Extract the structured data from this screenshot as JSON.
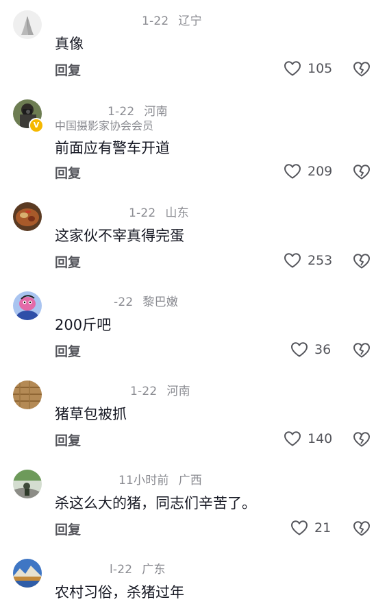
{
  "comments": [
    {
      "date": "1-22",
      "location": "辽宁",
      "badge": "",
      "text": "真像",
      "reply": "回复",
      "likes": "105",
      "avatar_icon": "praying-hands-avatar"
    },
    {
      "date": "1-22",
      "location": "河南",
      "badge": "中国摄影家协会会员",
      "text": "前面应有警车开道",
      "reply": "回复",
      "likes": "209",
      "avatar_icon": "photographer-avatar",
      "verified_mark": "V"
    },
    {
      "date": "1-22",
      "location": "山东",
      "badge": "",
      "text": "这家伙不宰真得完蛋",
      "reply": "回复",
      "likes": "253",
      "avatar_icon": "food-bowl-avatar"
    },
    {
      "date": "-22",
      "location": "黎巴嫩",
      "badge": "",
      "text": "200斤吧",
      "reply": "回复",
      "likes": "36",
      "avatar_icon": "cartoon-character-avatar"
    },
    {
      "date": "1-22",
      "location": "河南",
      "badge": "",
      "text": "猪草包被抓",
      "reply": "回复",
      "likes": "140",
      "avatar_icon": "wood-texture-avatar"
    },
    {
      "date": "11小时前",
      "location": "广西",
      "badge": "",
      "text": "杀这么大的猪，同志们辛苦了。",
      "reply": "回复",
      "likes": "21",
      "avatar_icon": "outdoor-scene-avatar"
    },
    {
      "date": "l-22",
      "location": "广东",
      "badge": "",
      "text": "农村习俗，杀猪过年",
      "reply": "",
      "likes": "",
      "avatar_icon": "mountain-lake-avatar"
    }
  ],
  "colors": {
    "meta": "#8a8b91",
    "text": "#161823",
    "action": "#55565c"
  }
}
